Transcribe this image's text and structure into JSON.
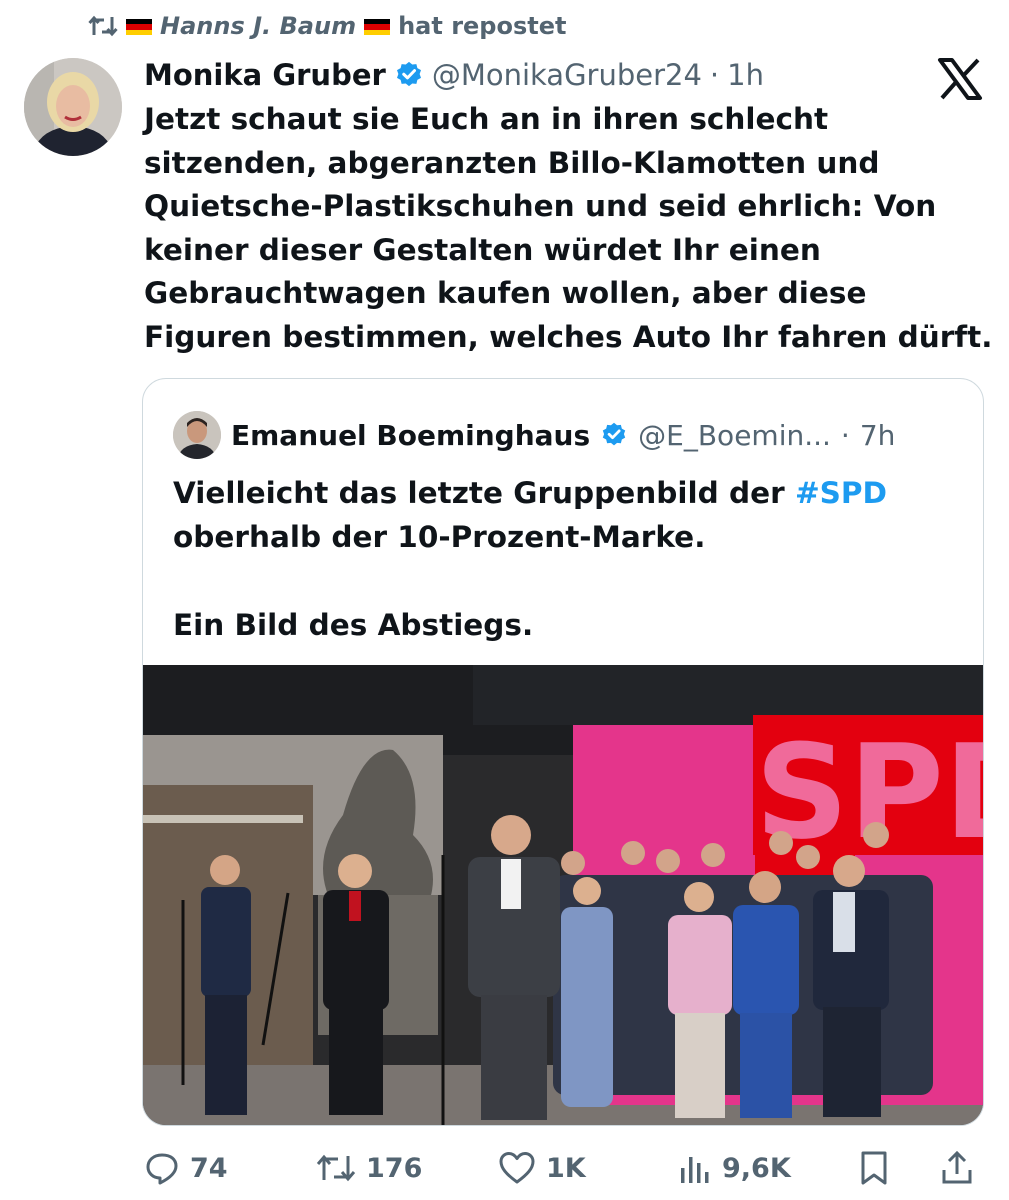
{
  "repost": {
    "icon": "repost-icon",
    "flag_left": "germany-flag",
    "reposter": "Hanns J. Baum",
    "flag_right": "germany-flag",
    "label": "hat repostet"
  },
  "tweet": {
    "author_name": "Monika Gruber",
    "handle": "@MonikaGruber24",
    "separator": "·",
    "time": "1h",
    "verified": true,
    "text": "Jetzt schaut sie Euch an in ihren schlecht sitzenden, abgeranzten Billo-Klamotten und Quietsche-Plastikschuhen und seid ehrlich: Von keiner dieser Gestalten würdet Ihr einen Gebrauchtwagen kaufen wollen, aber diese Figuren bestimmen, welches Auto Ihr fahren dürft."
  },
  "platform_logo": "x-logo",
  "quote": {
    "author_name": "Emanuel Boeminghaus",
    "handle": "@E_Boemin...",
    "separator": "·",
    "time": "7h",
    "verified": true,
    "text_part1": "Vielleicht das letzte Gruppenbild der ",
    "hashtag": "#SPD",
    "text_part2": " oberhalb der 10-Prozent-Marke.",
    "text_part3": "Ein Bild des Abstiegs.",
    "photo_wall_text": "SPD"
  },
  "actions": {
    "replies": "74",
    "reposts": "176",
    "likes": "1K",
    "views": "9,6K"
  },
  "colors": {
    "text_primary": "#0f1419",
    "text_secondary": "#536471",
    "verified_blue": "#1d9bf0",
    "hashtag_blue": "#1d9bf0",
    "spd_red": "#e3000f",
    "backdrop_pink": "#e8338a",
    "border": "#cfd9de"
  }
}
